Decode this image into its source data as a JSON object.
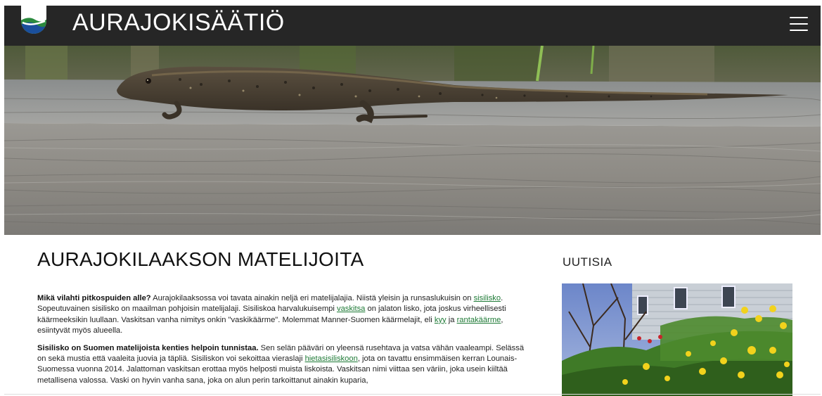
{
  "header": {
    "site_title": "AURAJOKISÄÄTIÖ",
    "logo_icon": "aurajoki-foundation-logo-icon",
    "menu_icon": "hamburger-menu-icon"
  },
  "hero": {
    "image": "lizard-on-wooden-plank-photo"
  },
  "article": {
    "title": "AURAJOKILAAKSON MATELIJOITA",
    "p1": {
      "lead": "Mikä vilahti pitkospuiden alle?",
      "t1": " Aurajokilaaksossa voi tavata ainakin neljä eri matelijalajia. Niistä yleisin ja runsaslukuisin on ",
      "link1": "sisilisko",
      "t2": ". Sopeutuvainen sisilisko on maailman pohjoisin matelijalaji. Sisiliskoa harvalukuisempi ",
      "link2": "vaskitsa",
      "t3": " on jalaton lisko, jota joskus virheellisesti käärmeeksikin luullaan. Vaskitsan vanha nimitys onkin \"vaskikäärme\". Molemmat Manner-Suomen käärmelajit, eli ",
      "link3": "kyy",
      "t4": " ja ",
      "link4": "rantakäärme",
      "t5": ", esiintyvät myös alueella."
    },
    "p2": {
      "lead": "Sisilisko on Suomen matelijoista kenties helpoin tunnistaa.",
      "t1": " Sen selän pääväri on yleensä rusehtava ja vatsa vähän vaaleampi. Selässä on sekä mustia että vaaleita juovia ja täpliä. Sisiliskon voi sekoittaa vieraslaji ",
      "link1": "hietasisiliskoon",
      "t2": ", jota on tavattu ensimmäisen kerran Lounais-Suomessa vuonna 2014. Jalattoman vaskitsan erottaa myös helposti muista liskoista. Vaskitsan nimi viittaa sen väriin, joka usein kiiltää metallisena valossa. Vaski on hyvin vanha sana, joka on alun perin tarkoittanut ainakin kuparia,"
    }
  },
  "sidebar": {
    "heading": "UUTISIA",
    "news_image": "garden-with-yellow-flowers-and-house-photo"
  },
  "colors": {
    "header_bg": "#262626",
    "link": "#1e7a36",
    "text": "#222222"
  }
}
